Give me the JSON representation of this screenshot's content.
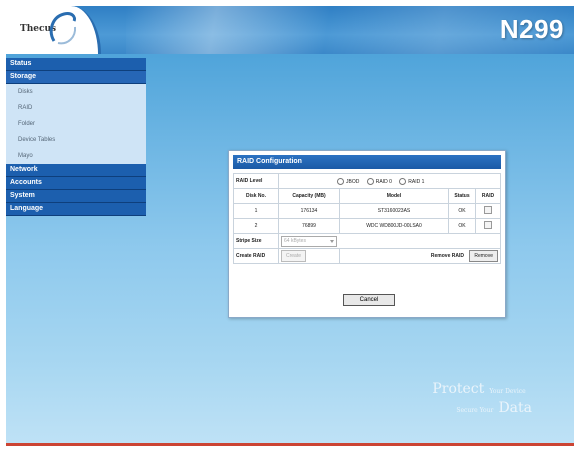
{
  "header": {
    "logo_text": "Thecus",
    "model": "N299"
  },
  "sidebar": {
    "categories": [
      {
        "label": "Status"
      },
      {
        "label": "Storage",
        "items": [
          "Disks",
          "RAID",
          "Folder",
          "Device Tables",
          "Mayo"
        ]
      },
      {
        "label": "Network"
      },
      {
        "label": "Accounts"
      },
      {
        "label": "System"
      },
      {
        "label": "Language"
      }
    ]
  },
  "dialog": {
    "title": "RAID Configuration",
    "raid_level_label": "RAID Level",
    "raid_options": [
      "JBOD",
      "RAID 0",
      "RAID 1"
    ],
    "columns": [
      "Disk No.",
      "Capacity (MB)",
      "Model",
      "Status",
      "RAID"
    ],
    "rows": [
      {
        "disk": "1",
        "capacity": "176134",
        "model": "ST3160023AS",
        "status": "OK"
      },
      {
        "disk": "2",
        "capacity": "76899",
        "model": "WDC WD800JD-00LSA0",
        "status": "OK"
      }
    ],
    "stripe_label": "Stripe Size",
    "stripe_value": "64 kBytes",
    "create_label": "Create RAID",
    "create_button": "Create",
    "remove_label": "Remove RAID",
    "remove_button": "Remove",
    "cancel_button": "Cancel"
  },
  "brand": {
    "word1": "Protect",
    "small1": "Your Device",
    "small2": "Secure Your",
    "word2": "Data"
  }
}
